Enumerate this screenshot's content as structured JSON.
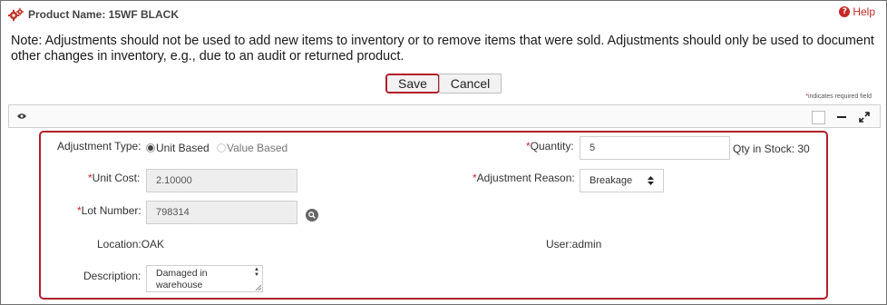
{
  "header": {
    "title": "Product Name: 15WF BLACK",
    "help_label": "Help"
  },
  "note": "Note: Adjustments should not be used to add new items to inventory or to remove items that were sold. Adjustments should only be used to document other changes in inventory, e.g., due to an audit or returned product.",
  "actions": {
    "save_label": "Save",
    "cancel_label": "Cancel"
  },
  "required_note": {
    "star": "*",
    "text": "indicates required field"
  },
  "form": {
    "adjustment_type": {
      "label": "Adjustment Type:",
      "options": [
        "Unit Based",
        "Value Based"
      ],
      "selected": "Unit Based"
    },
    "quantity": {
      "label": "Quantity:",
      "required": "*",
      "value": "5",
      "stock_text": "Qty in Stock: 30"
    },
    "unit_cost": {
      "label": "Unit Cost:",
      "required": "*",
      "value": "2.10000"
    },
    "adjustment_reason": {
      "label": "Adjustment Reason:",
      "required": "*",
      "value": "Breakage"
    },
    "lot_number": {
      "label": "Lot Number:",
      "required": "*",
      "value": "798314"
    },
    "location": "Location:OAK",
    "user": "User:admin",
    "description": {
      "label": "Description:",
      "value_line1": "Damaged in",
      "value_line2": "warehouse"
    }
  },
  "colors": {
    "accent_red": "#b01f2a",
    "required_red": "#c62828",
    "readonly_bg": "#eeeeee"
  },
  "icons": {
    "title": "gears-icon",
    "help": "question-circle-icon",
    "panel_toggle": "eye-icon",
    "lot_lookup": "search-icon",
    "panel_select": "checkbox-icon",
    "panel_collapse": "minus-icon",
    "panel_expand": "expand-arrows-icon"
  }
}
